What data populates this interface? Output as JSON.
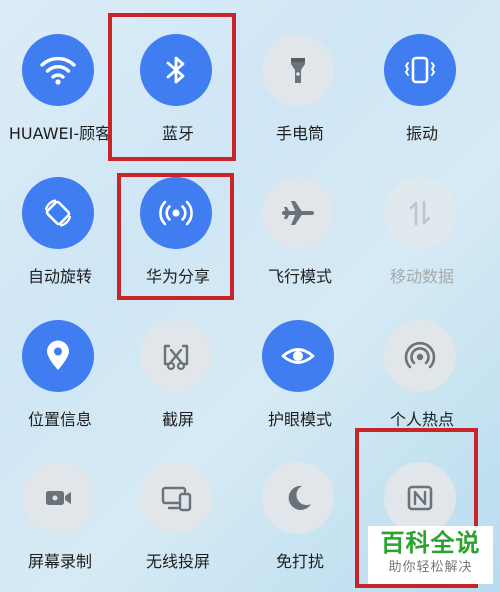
{
  "tiles": [
    {
      "label": "HUAWEI-顾客",
      "icon": "wifi-icon",
      "state": "active"
    },
    {
      "label": "蓝牙",
      "icon": "bluetooth-icon",
      "state": "active"
    },
    {
      "label": "手电筒",
      "icon": "flashlight-icon",
      "state": "inactive"
    },
    {
      "label": "振动",
      "icon": "vibrate-icon",
      "state": "active"
    },
    {
      "label": "自动旋转",
      "icon": "rotate-icon",
      "state": "active"
    },
    {
      "label": "华为分享",
      "icon": "huawei-share-icon",
      "state": "active"
    },
    {
      "label": "飞行模式",
      "icon": "airplane-icon",
      "state": "inactive"
    },
    {
      "label": "移动数据",
      "icon": "mobile-data-icon",
      "state": "disabled"
    },
    {
      "label": "位置信息",
      "icon": "location-icon",
      "state": "active"
    },
    {
      "label": "截屏",
      "icon": "screenshot-icon",
      "state": "inactive"
    },
    {
      "label": "护眼模式",
      "icon": "eye-icon",
      "state": "active"
    },
    {
      "label": "个人热点",
      "icon": "hotspot-icon",
      "state": "inactive"
    },
    {
      "label": "屏幕录制",
      "icon": "screen-record-icon",
      "state": "inactive"
    },
    {
      "label": "无线投屏",
      "icon": "wireless-projection-icon",
      "state": "inactive"
    },
    {
      "label": "免打扰",
      "icon": "moon-icon",
      "state": "inactive"
    },
    {
      "label": "",
      "icon": "nfc-icon",
      "state": "inactive"
    }
  ],
  "watermark": {
    "title": "百科全说",
    "subtitle": "助你轻松解决"
  },
  "colors": {
    "accent": "#3f7df1",
    "inactive_bg": "#e1e6ea",
    "highlight": "#c8242a",
    "watermark_green": "#2aa32f"
  }
}
